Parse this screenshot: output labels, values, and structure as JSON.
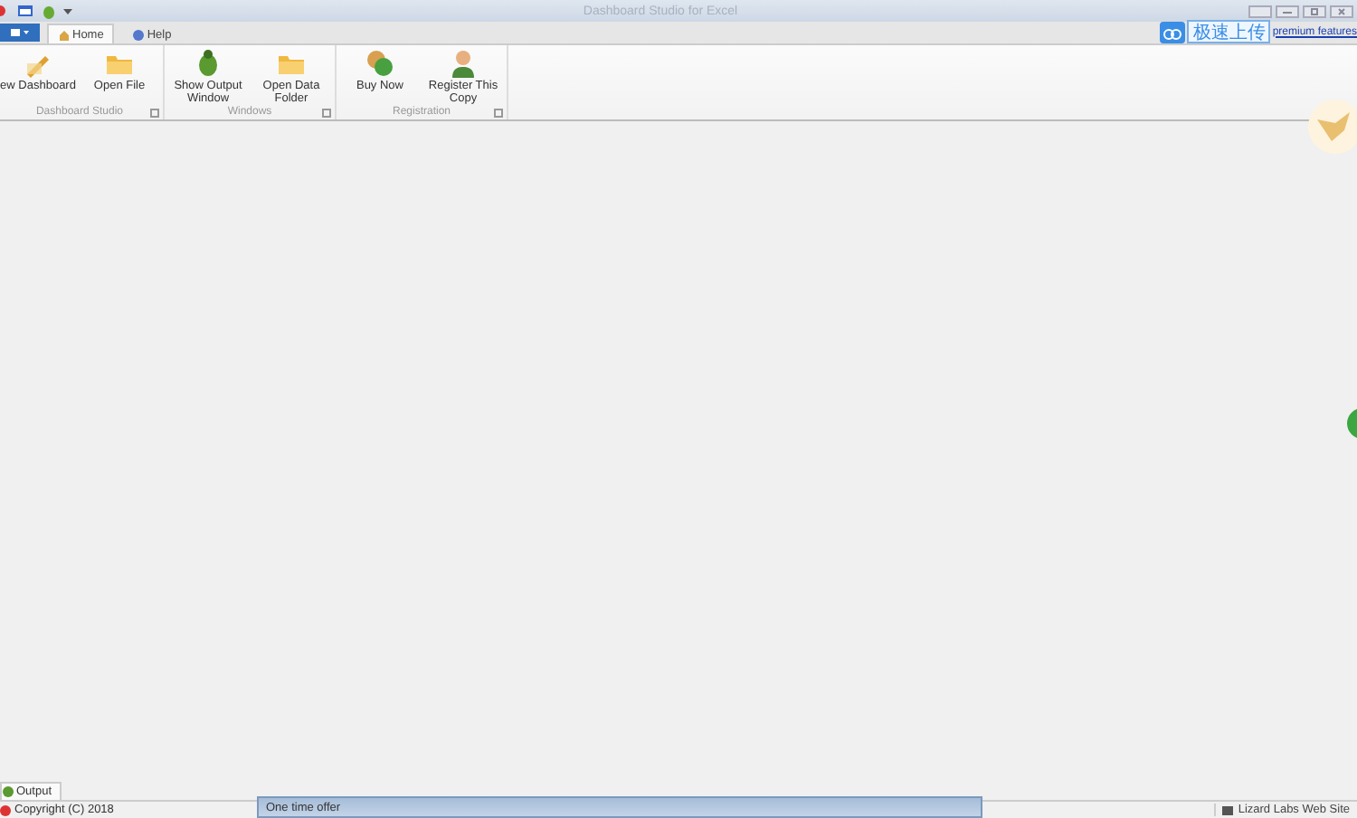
{
  "window": {
    "title": "Dashboard Studio for Excel"
  },
  "tabs": [
    {
      "label": "Home",
      "selected": true
    },
    {
      "label": "Help",
      "selected": false
    }
  ],
  "upload_button": {
    "label": "极速上传"
  },
  "premium_link": "premium features",
  "ribbon": {
    "groups": [
      {
        "name": "Dashboard Studio",
        "buttons": [
          {
            "label": "ew Dashboard",
            "kind": "pencil"
          },
          {
            "label": "Open File",
            "kind": "folder"
          }
        ]
      },
      {
        "name": "Windows",
        "buttons": [
          {
            "label": "Show Output Window",
            "kind": "bug"
          },
          {
            "label": "Open Data Folder",
            "kind": "folder"
          }
        ]
      },
      {
        "name": "Registration",
        "buttons": [
          {
            "label": "Buy Now",
            "kind": "coins"
          },
          {
            "label": "Register This Copy",
            "kind": "person"
          }
        ]
      }
    ]
  },
  "output_tab": {
    "label": "Output"
  },
  "status_bar": {
    "copyright": "Copyright (C) 2018",
    "website": "Lizard Labs Web Site"
  },
  "popup": {
    "title": "One time offer"
  }
}
